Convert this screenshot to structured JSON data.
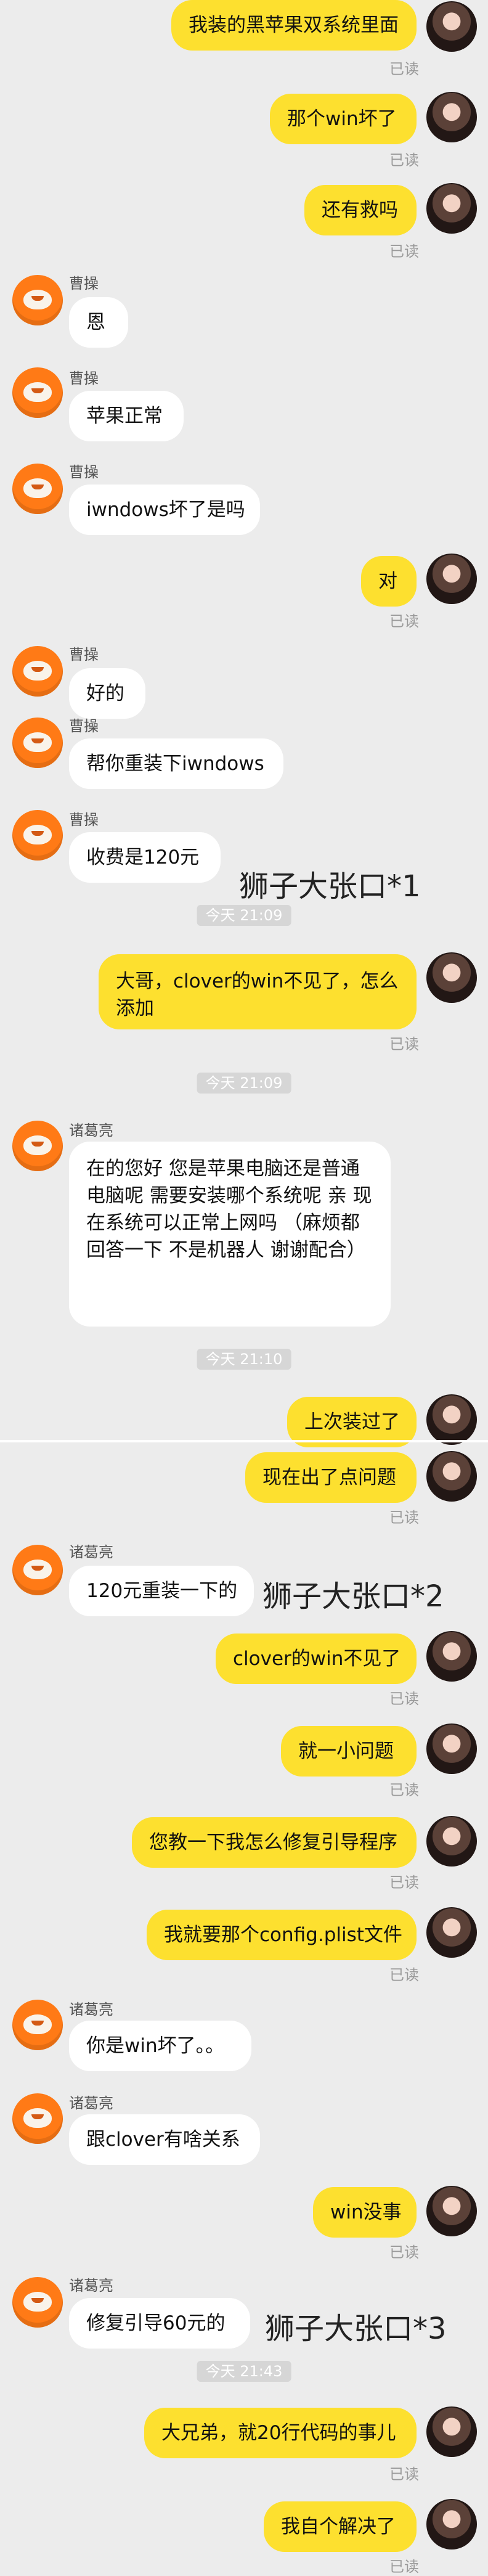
{
  "top_section": {
    "messages": [
      {
        "type": "out",
        "text": "我装的黑苹果双系统里面",
        "read": "已读"
      },
      {
        "type": "out",
        "text": "那个win坏了",
        "read": "已读"
      },
      {
        "type": "out",
        "text": "还有救吗",
        "read": "已读"
      },
      {
        "type": "in",
        "sender": "曹操",
        "text": "恩"
      },
      {
        "type": "in",
        "sender": "曹操",
        "text": "苹果正常"
      },
      {
        "type": "in",
        "sender": "曹操",
        "text": "iwndows坏了是吗"
      },
      {
        "type": "out",
        "text": "对",
        "read": "已读"
      },
      {
        "type": "in",
        "sender": "曹操",
        "text": "好的"
      },
      {
        "type": "in",
        "sender": "曹操",
        "text": "帮你重装下iwndows"
      },
      {
        "type": "in",
        "sender": "曹操",
        "text": "收费是120元",
        "annotation": "狮子大张口*1"
      },
      {
        "type": "time",
        "text": "今天 21:09"
      },
      {
        "type": "out",
        "text": "大哥，clover的win不见了，怎么添加",
        "read": "已读",
        "multiline": true
      },
      {
        "type": "time",
        "text": "今天 21:09"
      },
      {
        "type": "in",
        "sender": "诸葛亮",
        "text": "在的您好 您是苹果电脑还是普通电脑呢 需要安装哪个系统呢 亲 现在系统可以正常上网吗 （麻烦都回答一下 不是机器人 谢谢配合）",
        "multiline": true
      },
      {
        "type": "time",
        "text": "今天 21:10"
      },
      {
        "type": "out",
        "text": "上次装过了"
      }
    ]
  },
  "bottom_section": {
    "messages": [
      {
        "type": "out",
        "text": "现在出了点问题",
        "read": "已读"
      },
      {
        "type": "in",
        "sender": "诸葛亮",
        "text": "120元重装一下的",
        "annotation": "狮子大张口*2"
      },
      {
        "type": "out",
        "text": "clover的win不见了",
        "read": "已读"
      },
      {
        "type": "out",
        "text": "就一小问题",
        "read": "已读"
      },
      {
        "type": "out",
        "text": "您教一下我怎么修复引导程序",
        "read": "已读"
      },
      {
        "type": "out",
        "text": "我就要那个config.plist文件",
        "read": "已读"
      },
      {
        "type": "in",
        "sender": "诸葛亮",
        "text": "你是win坏了。。"
      },
      {
        "type": "in",
        "sender": "诸葛亮",
        "text": "跟clover有啥关系"
      },
      {
        "type": "out",
        "text": "win没事",
        "read": "已读"
      },
      {
        "type": "in",
        "sender": "诸葛亮",
        "text": "修复引导60元的",
        "annotation": "狮子大张口*3"
      },
      {
        "type": "time",
        "text": "今天 21:43"
      },
      {
        "type": "out",
        "text": "大兄弟，就20行代码的事儿",
        "read": "已读"
      },
      {
        "type": "out",
        "text": "我自个解决了",
        "read": "已读"
      }
    ]
  }
}
